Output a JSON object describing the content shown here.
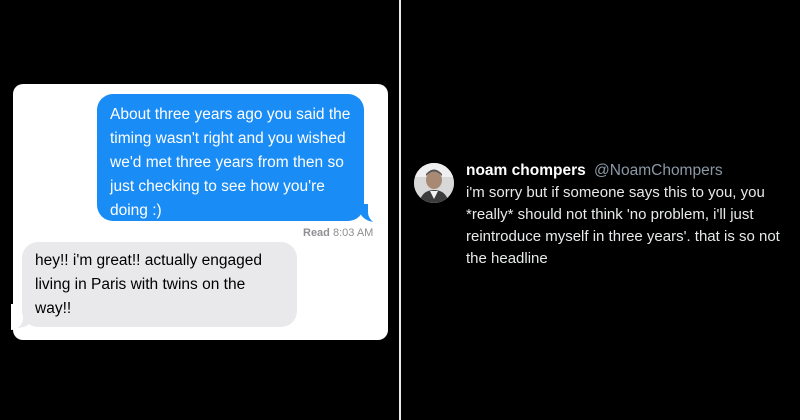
{
  "left_panel": {
    "sent_message": "About three years ago you said the timing wasn't right and you wished we'd met three years from then so just checking to see how you're doing :)",
    "read_label": "Read",
    "read_time": "8:03 AM",
    "received_message": "hey!! i'm great!! actually engaged living in Paris with twins on the way!!",
    "colors": {
      "sent_bubble": "#1a8cf5",
      "received_bubble": "#e9e9eb"
    }
  },
  "right_panel": {
    "display_name": "noam chompers",
    "handle": "@NoamChompers",
    "tweet_text": "i'm sorry but if someone says this to you, you *really* should not think 'no problem, i'll just reintroduce myself in three years'. that is so not the headline",
    "avatar_icon": "user-avatar-photo"
  }
}
